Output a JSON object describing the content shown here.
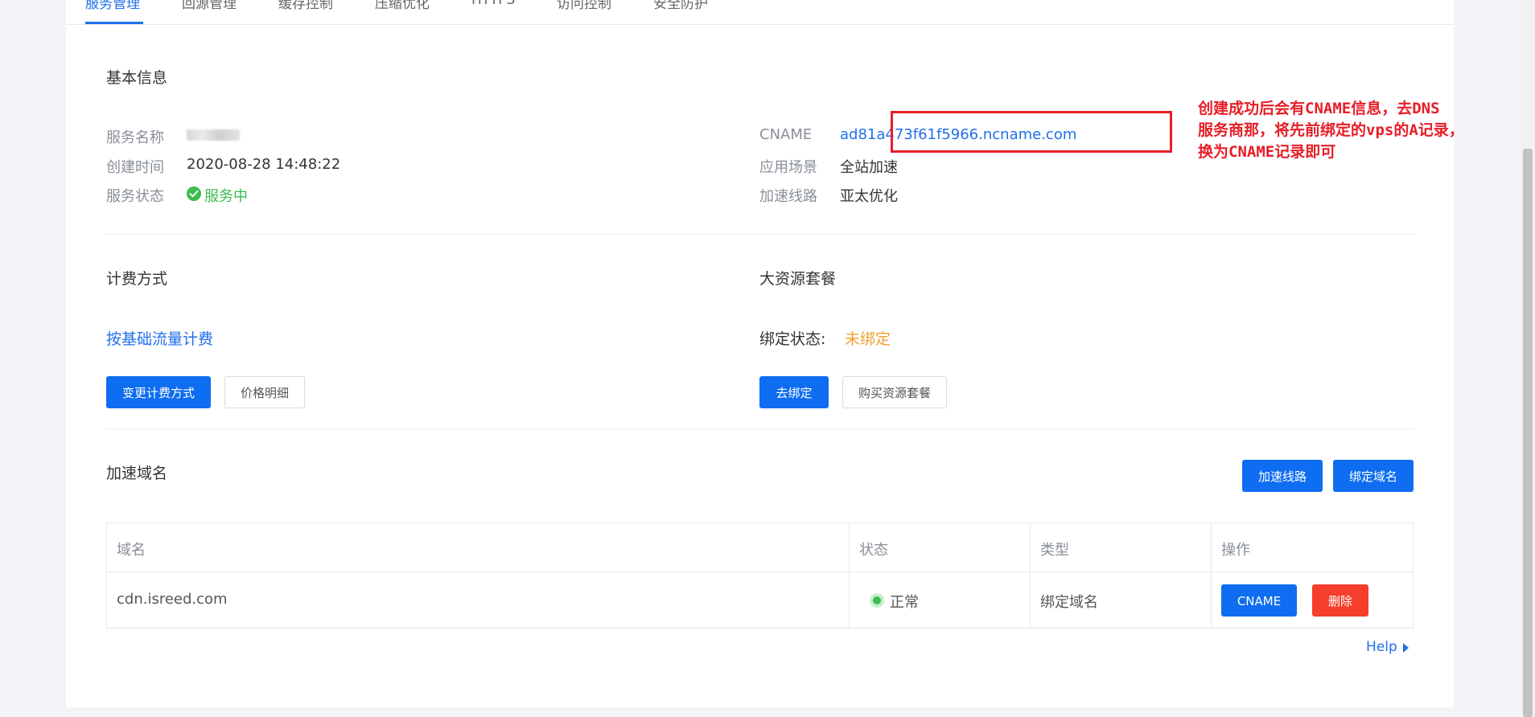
{
  "tabs": [
    {
      "label": "服务管理",
      "active": true
    },
    {
      "label": "回源管理"
    },
    {
      "label": "缓存控制"
    },
    {
      "label": "压缩优化"
    },
    {
      "label": "HTTPS"
    },
    {
      "label": "访问控制"
    },
    {
      "label": "安全防护"
    }
  ],
  "basic_info": {
    "title": "基本信息",
    "service_name_label": "服务名称",
    "created_label": "创建时间",
    "created_value": "2020-08-28 14:48:22",
    "status_label": "服务状态",
    "status_value": "服务中",
    "cname_label": "CNAME",
    "cname_value": "ad81a473f61f5966.ncname.com",
    "scenario_label": "应用场景",
    "scenario_value": "全站加速",
    "route_label": "加速线路",
    "route_value": "亚太优化"
  },
  "annotation": {
    "line1": "创建成功后会有CNAME信息，去DNS",
    "line2": "服务商那，将先前绑定的vps的A记录，",
    "line3": "换为CNAME记录即可"
  },
  "billing": {
    "title": "计费方式",
    "method": "按基础流量计费",
    "change_button": "变更计费方式",
    "price_button": "价格明细"
  },
  "resource_package": {
    "title": "大资源套餐",
    "bind_label": "绑定状态:",
    "bind_value": "未绑定",
    "bind_button": "去绑定",
    "buy_button": "购买资源套餐"
  },
  "domains": {
    "title": "加速域名",
    "route_button": "加速线路",
    "bind_domain_button": "绑定域名",
    "columns": [
      "域名",
      "状态",
      "类型",
      "操作"
    ],
    "rows": [
      {
        "domain": "cdn.isreed.com",
        "status": "正常",
        "type": "绑定域名",
        "cname_button": "CNAME",
        "delete_button": "删除"
      }
    ]
  },
  "help_link": "Help",
  "colors": {
    "primary": "#0e6df0",
    "success": "#3dbb4f",
    "warning": "#f0a030",
    "danger": "#f53f2c",
    "annotation": "#e61e28"
  }
}
